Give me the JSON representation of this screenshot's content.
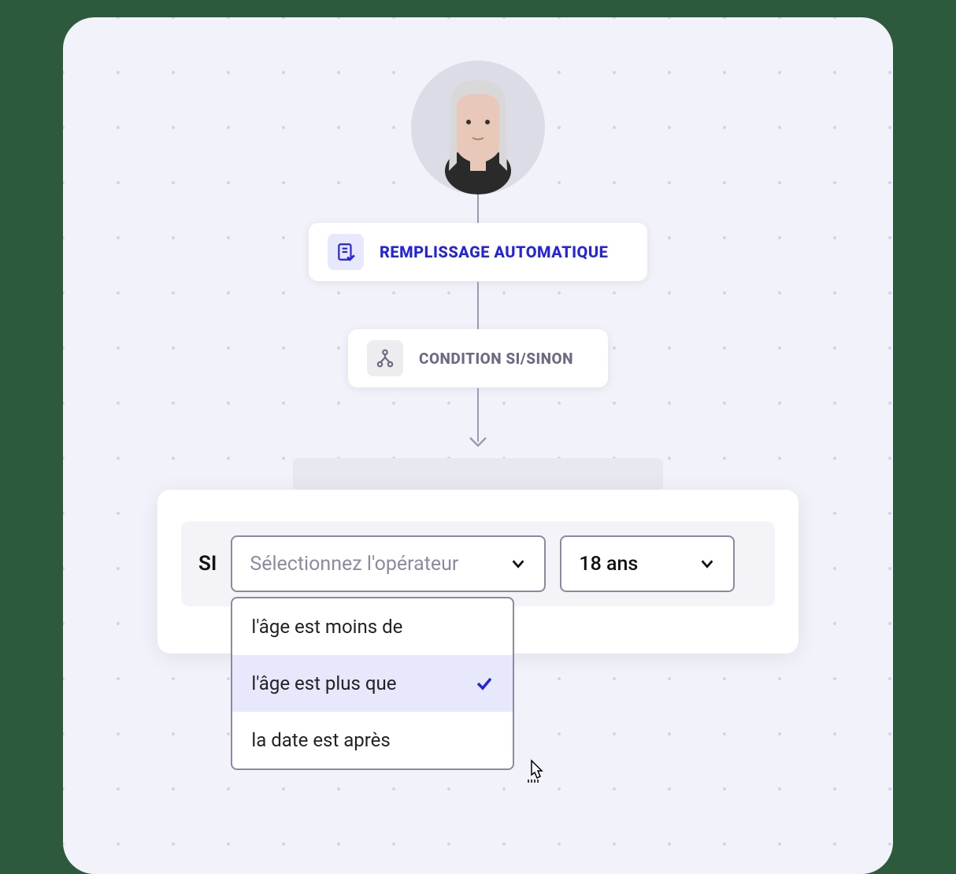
{
  "nodes": {
    "autofill": {
      "label": "REMPLISSAGE AUTOMATIQUE"
    },
    "condition": {
      "label": "CONDITION SI/SINON"
    }
  },
  "condition_row": {
    "if_label": "SI",
    "operator_placeholder": "Sélectionnez l'opérateur",
    "value_selected": "18 ans"
  },
  "operator_options": [
    {
      "label": "l'âge est moins de",
      "selected": false
    },
    {
      "label": "l'âge est plus que",
      "selected": true
    },
    {
      "label": "la date est après",
      "selected": false
    }
  ],
  "colors": {
    "accent": "#2424dd",
    "bg": "#f2f2fb"
  }
}
